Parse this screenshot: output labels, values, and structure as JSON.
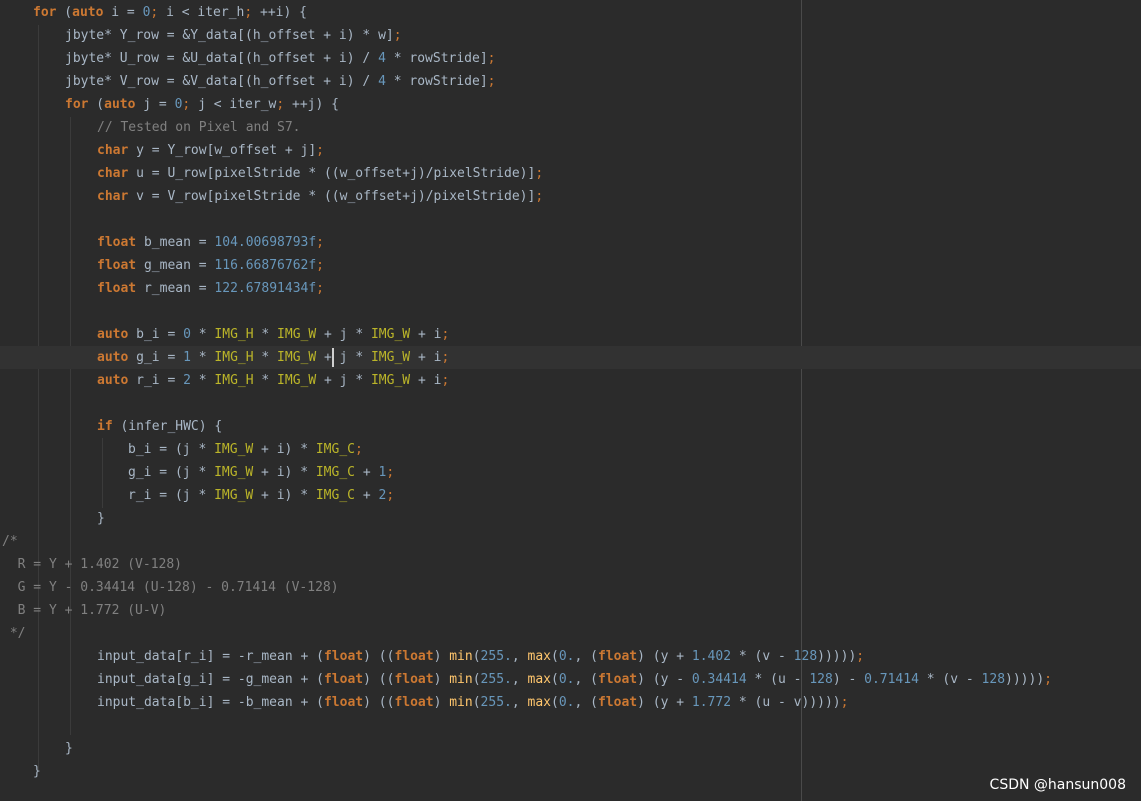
{
  "editor": {
    "lines": [
      {
        "indent": 33,
        "tokens": [
          [
            "kw",
            "for"
          ],
          [
            "t",
            " ("
          ],
          [
            "kw",
            "auto"
          ],
          [
            "t",
            " i = "
          ],
          [
            "num",
            "0"
          ],
          [
            "punct",
            ";"
          ],
          [
            "t",
            " i < iter_h"
          ],
          [
            "punct",
            ";"
          ],
          [
            "t",
            " ++i) {"
          ]
        ]
      },
      {
        "indent": 65,
        "tokens": [
          [
            "t",
            "jbyte* Y_row = &Y_data[(h_offset + i) * w]"
          ],
          [
            "punct",
            ";"
          ]
        ]
      },
      {
        "indent": 65,
        "tokens": [
          [
            "t",
            "jbyte* U_row = &U_data[(h_offset + i) / "
          ],
          [
            "num",
            "4"
          ],
          [
            "t",
            " * rowStride]"
          ],
          [
            "punct",
            ";"
          ]
        ]
      },
      {
        "indent": 65,
        "tokens": [
          [
            "t",
            "jbyte* V_row = &V_data[(h_offset + i) / "
          ],
          [
            "num",
            "4"
          ],
          [
            "t",
            " * rowStride]"
          ],
          [
            "punct",
            ";"
          ]
        ]
      },
      {
        "indent": 65,
        "tokens": [
          [
            "kw",
            "for"
          ],
          [
            "t",
            " ("
          ],
          [
            "kw",
            "auto"
          ],
          [
            "t",
            " j = "
          ],
          [
            "num",
            "0"
          ],
          [
            "punct",
            ";"
          ],
          [
            "t",
            " j < iter_w"
          ],
          [
            "punct",
            ";"
          ],
          [
            "t",
            " ++j) {"
          ]
        ]
      },
      {
        "indent": 97,
        "tokens": [
          [
            "cmt",
            "// Tested on Pixel and S7."
          ]
        ]
      },
      {
        "indent": 97,
        "tokens": [
          [
            "kw",
            "char"
          ],
          [
            "t",
            " y = Y_row[w_offset + j]"
          ],
          [
            "punct",
            ";"
          ]
        ]
      },
      {
        "indent": 97,
        "tokens": [
          [
            "kw",
            "char"
          ],
          [
            "t",
            " u = U_row[pixelStride * ((w_offset+j)/pixelStride)]"
          ],
          [
            "punct",
            ";"
          ]
        ]
      },
      {
        "indent": 97,
        "tokens": [
          [
            "kw",
            "char"
          ],
          [
            "t",
            " v = V_row[pixelStride * ((w_offset+j)/pixelStride)]"
          ],
          [
            "punct",
            ";"
          ]
        ]
      },
      {
        "indent": 97,
        "tokens": []
      },
      {
        "indent": 97,
        "tokens": [
          [
            "kw",
            "float"
          ],
          [
            "t",
            " b_mean = "
          ],
          [
            "num",
            "104.00698793f"
          ],
          [
            "punct",
            ";"
          ]
        ]
      },
      {
        "indent": 97,
        "tokens": [
          [
            "kw",
            "float"
          ],
          [
            "t",
            " g_mean = "
          ],
          [
            "num",
            "116.66876762f"
          ],
          [
            "punct",
            ";"
          ]
        ]
      },
      {
        "indent": 97,
        "tokens": [
          [
            "kw",
            "float"
          ],
          [
            "t",
            " r_mean = "
          ],
          [
            "num",
            "122.67891434f"
          ],
          [
            "punct",
            ";"
          ]
        ]
      },
      {
        "indent": 97,
        "tokens": []
      },
      {
        "indent": 97,
        "tokens": [
          [
            "kw",
            "auto"
          ],
          [
            "t",
            " b_i = "
          ],
          [
            "num",
            "0"
          ],
          [
            "t",
            " * "
          ],
          [
            "mac",
            "IMG_H"
          ],
          [
            "t",
            " * "
          ],
          [
            "mac",
            "IMG_W"
          ],
          [
            "t",
            " + j * "
          ],
          [
            "mac",
            "IMG_W"
          ],
          [
            "t",
            " + i"
          ],
          [
            "punct",
            ";"
          ]
        ]
      },
      {
        "indent": 97,
        "current": true,
        "tokens": [
          [
            "kw",
            "auto"
          ],
          [
            "t",
            " g_i = "
          ],
          [
            "num",
            "1"
          ],
          [
            "t",
            " * "
          ],
          [
            "mac",
            "IMG_H"
          ],
          [
            "t",
            " * "
          ],
          [
            "mac",
            "IMG_W"
          ],
          [
            "t",
            " + j * "
          ],
          [
            "mac",
            "IMG_W"
          ],
          [
            "t",
            " + i"
          ],
          [
            "punct",
            ";"
          ]
        ]
      },
      {
        "indent": 97,
        "tokens": [
          [
            "kw",
            "auto"
          ],
          [
            "t",
            " r_i = "
          ],
          [
            "num",
            "2"
          ],
          [
            "t",
            " * "
          ],
          [
            "mac",
            "IMG_H"
          ],
          [
            "t",
            " * "
          ],
          [
            "mac",
            "IMG_W"
          ],
          [
            "t",
            " + j * "
          ],
          [
            "mac",
            "IMG_W"
          ],
          [
            "t",
            " + i"
          ],
          [
            "punct",
            ";"
          ]
        ]
      },
      {
        "indent": 97,
        "tokens": []
      },
      {
        "indent": 97,
        "tokens": [
          [
            "kw",
            "if"
          ],
          [
            "t",
            " (infer_HWC) {"
          ]
        ]
      },
      {
        "indent": 128,
        "tokens": [
          [
            "t",
            "b_i = (j * "
          ],
          [
            "mac",
            "IMG_W"
          ],
          [
            "t",
            " + i) * "
          ],
          [
            "mac",
            "IMG_C"
          ],
          [
            "punct",
            ";"
          ]
        ]
      },
      {
        "indent": 128,
        "tokens": [
          [
            "t",
            "g_i = (j * "
          ],
          [
            "mac",
            "IMG_W"
          ],
          [
            "t",
            " + i) * "
          ],
          [
            "mac",
            "IMG_C"
          ],
          [
            "t",
            " + "
          ],
          [
            "num",
            "1"
          ],
          [
            "punct",
            ";"
          ]
        ]
      },
      {
        "indent": 128,
        "tokens": [
          [
            "t",
            "r_i = (j * "
          ],
          [
            "mac",
            "IMG_W"
          ],
          [
            "t",
            " + i) * "
          ],
          [
            "mac",
            "IMG_C"
          ],
          [
            "t",
            " + "
          ],
          [
            "num",
            "2"
          ],
          [
            "punct",
            ";"
          ]
        ]
      },
      {
        "indent": 97,
        "tokens": [
          [
            "t",
            "}"
          ]
        ]
      },
      {
        "indent": 2,
        "tokens": [
          [
            "cmt",
            "/*"
          ]
        ]
      },
      {
        "indent": 2,
        "tokens": [
          [
            "cmt",
            "  R = Y + 1.402 (V-128)"
          ]
        ]
      },
      {
        "indent": 2,
        "tokens": [
          [
            "cmt",
            "  G = Y - 0.34414 (U-128) - 0.71414 (V-128)"
          ]
        ]
      },
      {
        "indent": 2,
        "tokens": [
          [
            "cmt",
            "  B = Y + 1.772 (U-V)"
          ]
        ]
      },
      {
        "indent": 2,
        "tokens": [
          [
            "cmt",
            " */"
          ]
        ]
      },
      {
        "indent": 97,
        "tokens": [
          [
            "t",
            "input_data[r_i] = -r_mean + ("
          ],
          [
            "kw",
            "float"
          ],
          [
            "t",
            ") (("
          ],
          [
            "kw",
            "float"
          ],
          [
            "t",
            ") "
          ],
          [
            "fn",
            "min"
          ],
          [
            "t",
            "("
          ],
          [
            "num",
            "255."
          ],
          [
            "t",
            ", "
          ],
          [
            "fn",
            "max"
          ],
          [
            "t",
            "("
          ],
          [
            "num",
            "0."
          ],
          [
            "t",
            ", ("
          ],
          [
            "kw",
            "float"
          ],
          [
            "t",
            ") (y + "
          ],
          [
            "num",
            "1.402"
          ],
          [
            "t",
            " * (v - "
          ],
          [
            "num",
            "128"
          ],
          [
            "t",
            ")))))"
          ],
          [
            "punct",
            ";"
          ]
        ]
      },
      {
        "indent": 97,
        "tokens": [
          [
            "t",
            "input_data[g_i] = -g_mean + ("
          ],
          [
            "kw",
            "float"
          ],
          [
            "t",
            ") (("
          ],
          [
            "kw",
            "float"
          ],
          [
            "t",
            ") "
          ],
          [
            "fn",
            "min"
          ],
          [
            "t",
            "("
          ],
          [
            "num",
            "255."
          ],
          [
            "t",
            ", "
          ],
          [
            "fn",
            "max"
          ],
          [
            "t",
            "("
          ],
          [
            "num",
            "0."
          ],
          [
            "t",
            ", ("
          ],
          [
            "kw",
            "float"
          ],
          [
            "t",
            ") (y - "
          ],
          [
            "num",
            "0.34414"
          ],
          [
            "t",
            " * (u - "
          ],
          [
            "num",
            "128"
          ],
          [
            "t",
            ") - "
          ],
          [
            "num",
            "0.71414"
          ],
          [
            "t",
            " * (v - "
          ],
          [
            "num",
            "128"
          ],
          [
            "t",
            ")))))"
          ],
          [
            "punct",
            ";"
          ]
        ]
      },
      {
        "indent": 97,
        "tokens": [
          [
            "t",
            "input_data[b_i] = -b_mean + ("
          ],
          [
            "kw",
            "float"
          ],
          [
            "t",
            ") (("
          ],
          [
            "kw",
            "float"
          ],
          [
            "t",
            ") "
          ],
          [
            "fn",
            "min"
          ],
          [
            "t",
            "("
          ],
          [
            "num",
            "255."
          ],
          [
            "t",
            ", "
          ],
          [
            "fn",
            "max"
          ],
          [
            "t",
            "("
          ],
          [
            "num",
            "0."
          ],
          [
            "t",
            ", ("
          ],
          [
            "kw",
            "float"
          ],
          [
            "t",
            ") (y + "
          ],
          [
            "num",
            "1.772"
          ],
          [
            "t",
            " * (u - v)))))"
          ],
          [
            "punct",
            ";"
          ]
        ]
      },
      {
        "indent": 97,
        "tokens": []
      },
      {
        "indent": 65,
        "tokens": [
          [
            "t",
            "}"
          ]
        ]
      },
      {
        "indent": 33,
        "tokens": [
          [
            "t",
            "}"
          ]
        ]
      }
    ]
  },
  "watermark": "CSDN @hansun008"
}
